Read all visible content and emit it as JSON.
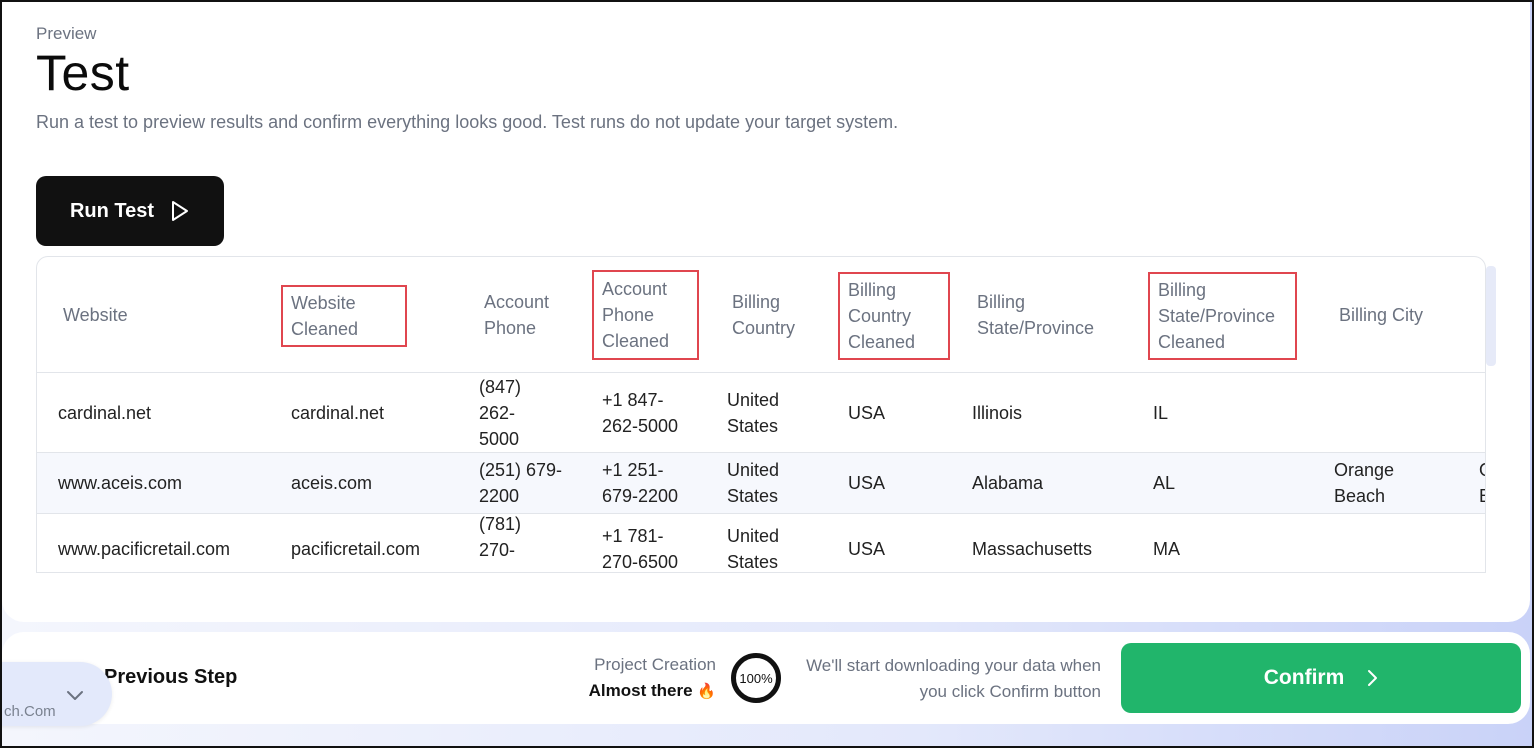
{
  "header": {
    "eyebrow": "Preview",
    "title": "Test",
    "subtitle": "Run a test to preview results and confirm everything looks good. Test runs do not update your target system.",
    "run_label": "Run Test"
  },
  "table": {
    "columns": [
      {
        "label": "Website",
        "highlighted": false
      },
      {
        "label": "Website Cleaned",
        "highlighted": true
      },
      {
        "label": "Account Phone",
        "highlighted": false
      },
      {
        "label": "Account Phone Cleaned",
        "highlighted": true
      },
      {
        "label": "Billing Country",
        "highlighted": false
      },
      {
        "label": "Billing Country Cleaned",
        "highlighted": true
      },
      {
        "label": "Billing State/Province",
        "highlighted": false
      },
      {
        "label": "Billing State/Province Cleaned",
        "highlighted": true
      },
      {
        "label": "Billing City",
        "highlighted": false
      }
    ],
    "rows": [
      [
        "cardinal.net",
        "cardinal.net",
        "(847) 262-5000",
        "+1 847-262-5000",
        "United States",
        "USA",
        "Illinois",
        "IL",
        "",
        ""
      ],
      [
        "www.aceis.com",
        "aceis.com",
        "(251) 679-2200",
        "+1 251-679-2200",
        "United States",
        "USA",
        "Alabama",
        "AL",
        "Orange Beach",
        "O B"
      ],
      [
        "www.pacificretail.com",
        "pacificretail.com",
        "(781) 270-",
        "+1 781-270-6500",
        "United States",
        "USA",
        "Massachusetts",
        "MA",
        "",
        ""
      ]
    ]
  },
  "footer": {
    "previous_label": "Previous Step",
    "project_label": "Project Creation",
    "project_status": "Almost there",
    "status_emoji": "🔥",
    "progress_label": "100%",
    "progress": 1.0,
    "download_note": "We'll start downloading your data when you click Confirm button",
    "confirm_label": "Confirm"
  },
  "popup": {
    "text": "ch.Com"
  },
  "colors": {
    "confirm": "#21b56b",
    "highlight_border": "#e0464f",
    "run_button": "#111111"
  }
}
